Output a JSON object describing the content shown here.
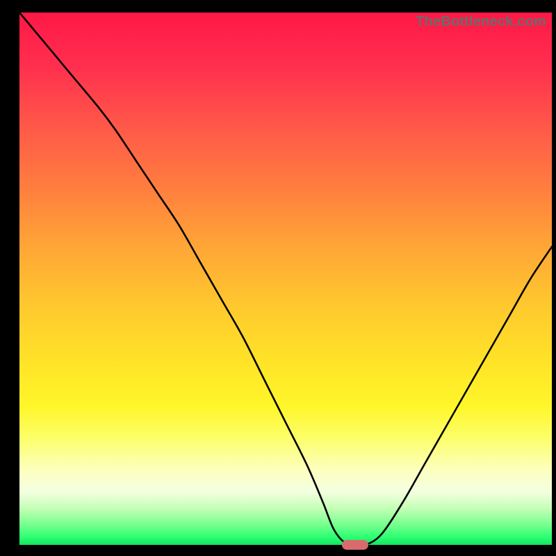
{
  "watermark": "TheBottleneck.com",
  "colors": {
    "frame": "#000000",
    "curve": "#000000",
    "marker": "#d96a6e",
    "gradient_top": "#ff1846",
    "gradient_bottom": "#11e561"
  },
  "chart_data": {
    "type": "line",
    "title": "",
    "xlabel": "",
    "ylabel": "",
    "xlim": [
      0,
      100
    ],
    "ylim": [
      0,
      100
    ],
    "x": [
      0,
      5,
      10,
      15,
      18,
      22,
      26,
      30,
      34,
      38,
      42,
      46,
      50,
      54,
      57,
      59,
      61,
      63,
      65,
      68,
      72,
      76,
      80,
      84,
      88,
      92,
      96,
      100
    ],
    "values": [
      100,
      94,
      88,
      82,
      78,
      72,
      66,
      60,
      53,
      46,
      39,
      31,
      23,
      15,
      8,
      3,
      0.5,
      0,
      0,
      2,
      8,
      15,
      22,
      29,
      36,
      43,
      50,
      56
    ],
    "marker_x": 63,
    "annotations": []
  }
}
